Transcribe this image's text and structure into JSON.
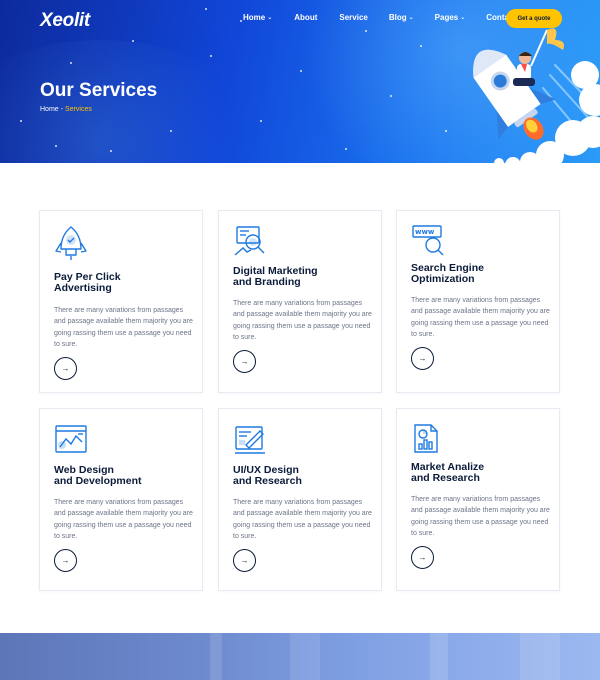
{
  "header": {
    "logo": "Xeolit",
    "nav": [
      {
        "label": "Home",
        "dropdown": true
      },
      {
        "label": "About",
        "dropdown": false
      },
      {
        "label": "Service",
        "dropdown": false
      },
      {
        "label": "Blog",
        "dropdown": true
      },
      {
        "label": "Pages",
        "dropdown": true
      },
      {
        "label": "Contact",
        "dropdown": false
      }
    ],
    "cta": "Get a quote"
  },
  "hero": {
    "title": "Our Services",
    "breadcrumb": {
      "home": "Home",
      "separator": "-",
      "current": "Services"
    }
  },
  "services": [
    {
      "icon": "rocket-icon",
      "title": "Pay Per Click\nAdvertising",
      "description": "There are many variations from passages and passage available them majority you are going rassing them use a passage you need to sure.",
      "arrow": "→"
    },
    {
      "icon": "marketing-search-icon",
      "title": "Digital Marketing\nand Branding",
      "description": "There are many variations from passages and passage available them majority you are going rassing them use a passage you need to sure.",
      "arrow": "→"
    },
    {
      "icon": "www-search-icon",
      "title": "Search Engine\nOptimization",
      "description": "There are many variations from passages and passage available them majority you are going rassing them use a passage you need to sure.",
      "arrow": "→"
    },
    {
      "icon": "web-design-icon",
      "title": "Web Design\nand Development",
      "description": "There are many variations from passages and passage available them majority you are going rassing them use a passage you need to sure.",
      "arrow": "→"
    },
    {
      "icon": "uiux-design-icon",
      "title": "UI/UX Design\nand Research",
      "description": "There are many variations from passages and passage available them majority you are going rassing them use a passage you need to sure.",
      "arrow": "→"
    },
    {
      "icon": "market-analysis-icon",
      "title": "Market Analize\nand Research",
      "description": "There are many variations from passages and passage available them majority you are going rassing them use a passage you need to sure.",
      "arrow": "→"
    }
  ],
  "colors": {
    "accent": "#ffc300",
    "hero_start": "#0d2a9c",
    "hero_end": "#2a9cf8",
    "icon_blue": "#1f7ae0",
    "heading": "#0b1b3a",
    "body_text": "#6b7488"
  }
}
